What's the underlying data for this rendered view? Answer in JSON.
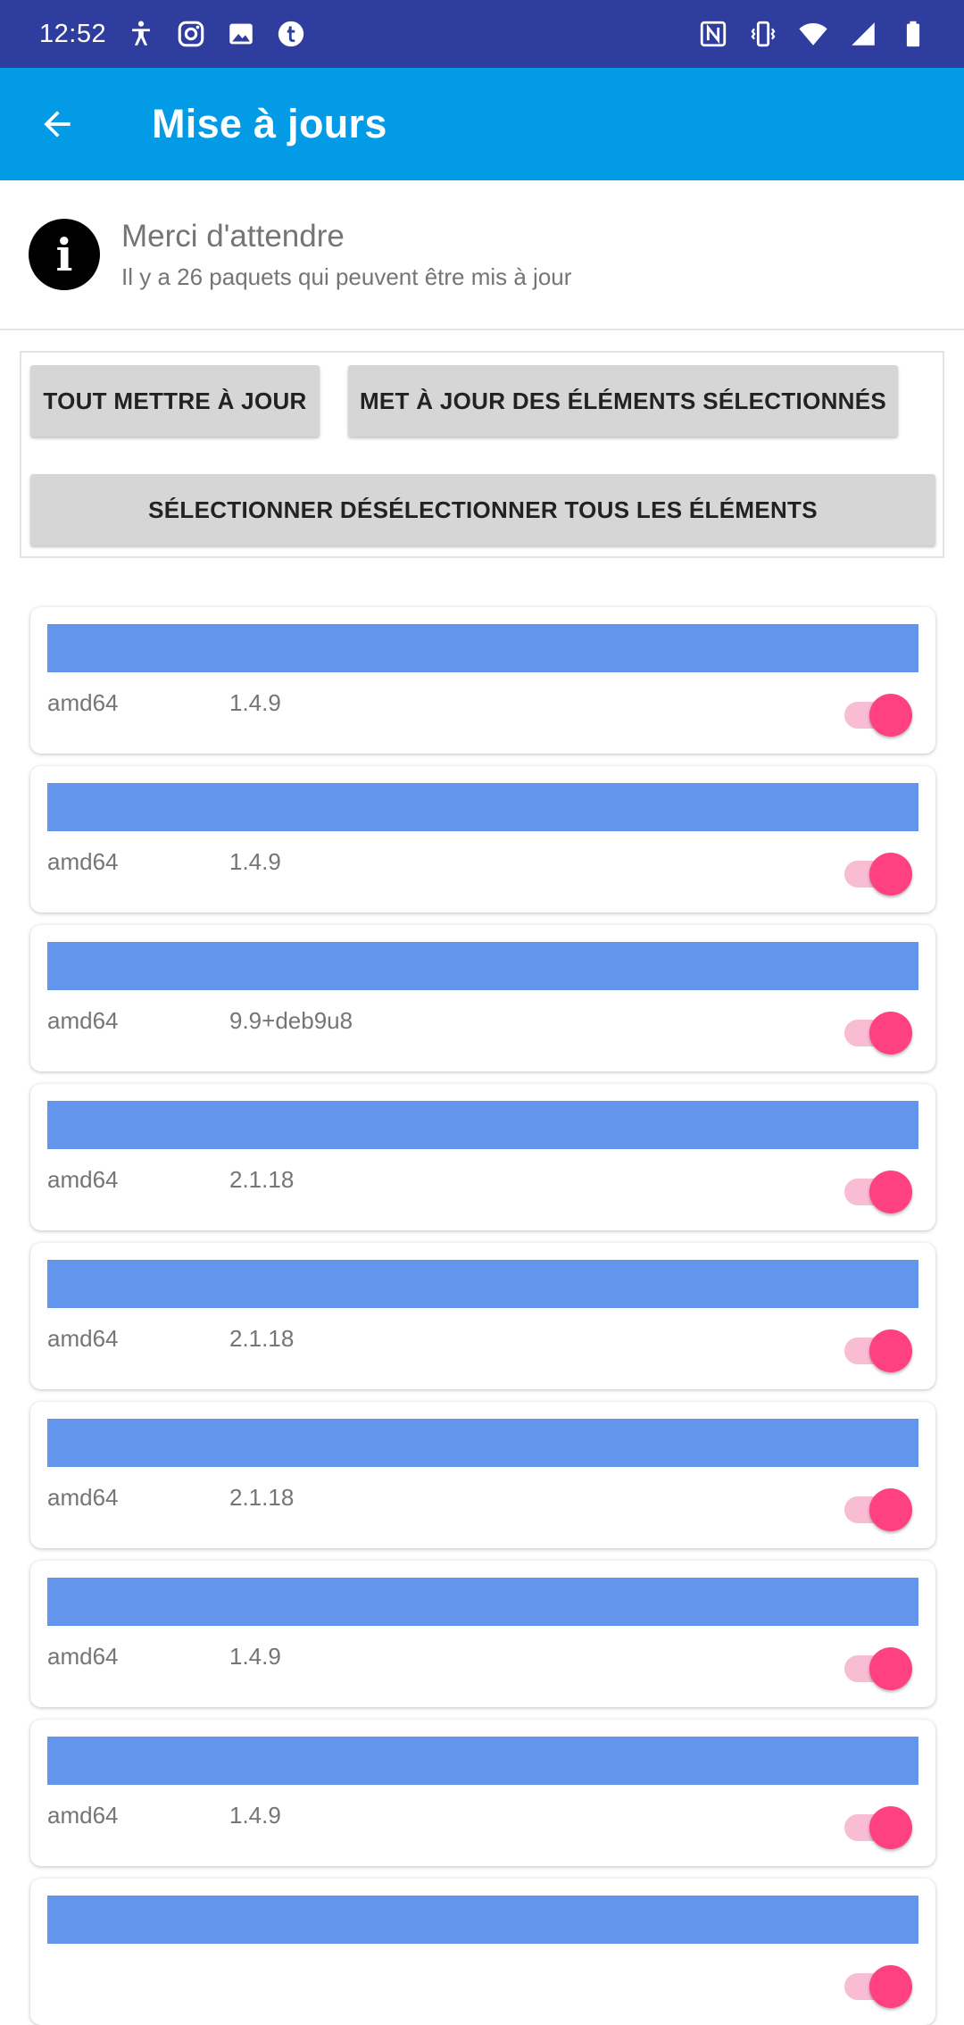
{
  "status_bar": {
    "time": "12:52",
    "left_icons": [
      "accessibility-icon",
      "instagram-icon",
      "image-icon",
      "tumblr-icon"
    ],
    "right_icons": [
      "nfc-icon",
      "vibrate-icon",
      "wifi-icon",
      "signal-icon",
      "battery-icon"
    ]
  },
  "app_bar": {
    "title": "Mise à jours",
    "back_icon": "arrow-back-icon"
  },
  "info": {
    "icon": "info-icon",
    "icon_glyph": "i",
    "title": "Merci d'attendre",
    "subtitle": "Il y a 26 paquets qui peuvent être mis à jour"
  },
  "buttons": {
    "update_all": "TOUT METTRE À JOUR",
    "update_selected": "MET À JOUR DES ÉLÉMENTS SÉLECTIONNÉS",
    "toggle_all": "SÉLECTIONNER DÉSÉLECTIONNER TOUS LES ÉLÉMENTS"
  },
  "colors": {
    "status_bar": "#2f3e9e",
    "app_bar": "#039be5",
    "package_bar": "#6495ed",
    "switch_thumb": "#ff4081",
    "switch_track": "#f8bcd3"
  },
  "packages": [
    {
      "arch": "amd64",
      "version": "1.4.9",
      "selected": true
    },
    {
      "arch": "amd64",
      "version": "1.4.9",
      "selected": true
    },
    {
      "arch": "amd64",
      "version": "9.9+deb9u8",
      "selected": true
    },
    {
      "arch": "amd64",
      "version": "2.1.18",
      "selected": true
    },
    {
      "arch": "amd64",
      "version": "2.1.18",
      "selected": true
    },
    {
      "arch": "amd64",
      "version": "2.1.18",
      "selected": true
    },
    {
      "arch": "amd64",
      "version": "1.4.9",
      "selected": true
    },
    {
      "arch": "amd64",
      "version": "1.4.9",
      "selected": true
    },
    {
      "arch": "",
      "version": "",
      "selected": true
    }
  ]
}
